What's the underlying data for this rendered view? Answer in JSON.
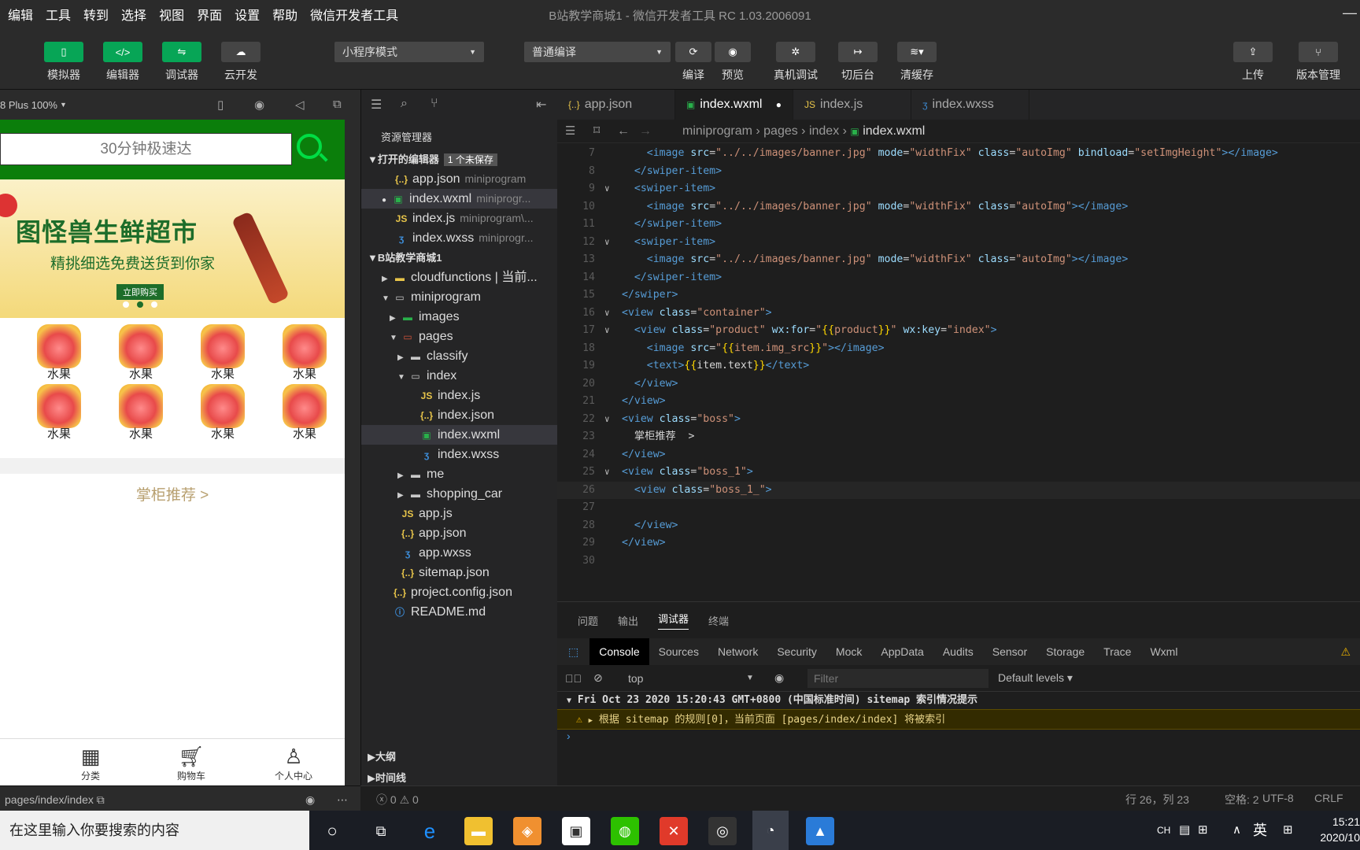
{
  "menu": {
    "items": [
      "编辑",
      "工具",
      "转到",
      "选择",
      "视图",
      "界面",
      "设置",
      "帮助",
      "微信开发者工具"
    ],
    "title": "B站教学商城1 - 微信开发者工具 RC 1.03.2006091"
  },
  "toolbar": {
    "simulator": "模拟器",
    "editor": "编辑器",
    "debugger": "调试器",
    "cloud": "云开发",
    "mode": "小程序模式",
    "compile_mode": "普通编译",
    "compile": "编译",
    "preview": "预览",
    "real_debug": "真机调试",
    "background": "切后台",
    "clear_cache": "清缓存",
    "upload": "上传",
    "version": "版本管理"
  },
  "simulator": {
    "device": "8 Plus 100%",
    "search_placeholder": "30分钟极速达",
    "banner_title": "图怪兽生鲜超市",
    "banner_subtitle": "精挑细选免费送货到你家",
    "banner_button": "立即购买",
    "product_label": "水果",
    "boss_label": "掌柜推荐 >",
    "tabs": [
      "分类",
      "购物车",
      "个人中心"
    ],
    "page_path": "pages/index/index"
  },
  "explorer": {
    "title": "资源管理器",
    "open_editors": "打开的编辑器",
    "unsaved": "1 个未保存",
    "open_files": [
      {
        "name": "app.json",
        "dir": "miniprogram"
      },
      {
        "name": "index.wxml",
        "dir": "miniprogr..."
      },
      {
        "name": "index.js",
        "dir": "miniprogram\\..."
      },
      {
        "name": "index.wxss",
        "dir": "miniprogr..."
      }
    ],
    "project": "B站教学商城1",
    "tree": [
      "cloudfunctions | 当前...",
      "miniprogram",
      "images",
      "pages",
      "classify",
      "index",
      "index.js",
      "index.json",
      "index.wxml",
      "index.wxss",
      "me",
      "shopping_car",
      "app.js",
      "app.json",
      "app.wxss",
      "sitemap.json",
      "project.config.json",
      "README.md"
    ],
    "outline": "大纲",
    "timeline": "时间线"
  },
  "editor": {
    "tabs": [
      "app.json",
      "index.wxml",
      "index.js",
      "index.wxss"
    ],
    "breadcrumb": [
      "miniprogram",
      "pages",
      "index",
      "index.wxml"
    ],
    "line_numbers": [
      "7",
      "8",
      "9",
      "10",
      "11",
      "12",
      "13",
      "14",
      "15",
      "16",
      "17",
      "18",
      "19",
      "20",
      "21",
      "22",
      "23",
      "24",
      "25",
      "26",
      "27",
      "28",
      "29",
      "30"
    ]
  },
  "panel": {
    "tabs": [
      "问题",
      "输出",
      "调试器",
      "终端"
    ],
    "devtools": [
      "Console",
      "Sources",
      "Network",
      "Security",
      "Mock",
      "AppData",
      "Audits",
      "Sensor",
      "Storage",
      "Trace",
      "Wxml"
    ],
    "context": "top",
    "filter": "Filter",
    "levels": "Default levels ▾",
    "log_header": "Fri Oct 23 2020 15:20:43 GMT+0800 (中国标准时间) sitemap 索引情况提示",
    "log_warning": "根据 sitemap 的规则[0]，当前页面 [pages/index/index] 将被索引"
  },
  "status": {
    "errors": "0",
    "warnings": "0",
    "position": "行 26，列 23",
    "spaces": "空格: 2",
    "encoding": "UTF-8",
    "eol": "CRLF"
  },
  "taskbar": {
    "search": "在这里输入你要搜索的内容",
    "ime": "英",
    "time": "15:21",
    "date": "2020/10"
  }
}
